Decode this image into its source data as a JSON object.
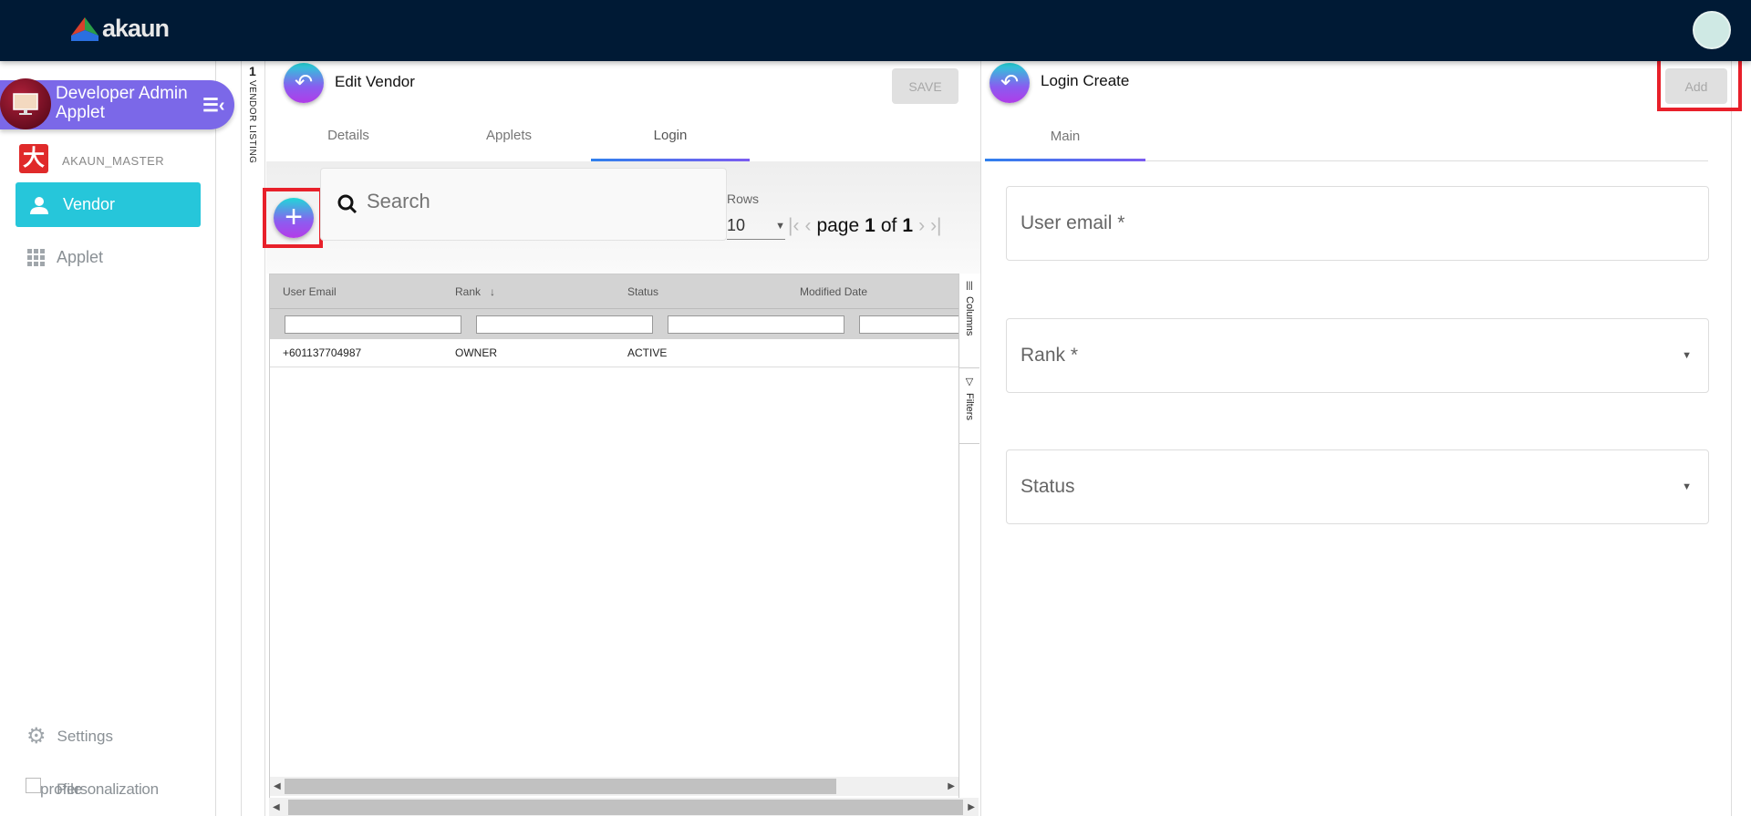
{
  "header": {
    "logo_text": "akaun",
    "avatar": "user-avatar"
  },
  "sidebar": {
    "app_title_line1": "Developer Admin",
    "app_title_line2": "Applet",
    "tenant": "AKAUN_MASTER",
    "items": [
      {
        "label": "Vendor",
        "icon": "person-icon",
        "active": true
      },
      {
        "label": "Applet",
        "icon": "grid-icon"
      }
    ],
    "settings": "Settings",
    "personalization_overlap_1": "profile",
    "personalization_overlap_2": "Personalization"
  },
  "strip": {
    "count": "1",
    "label": "VENDOR LISTING"
  },
  "left_panel": {
    "title": "Edit Vendor",
    "save_label": "SAVE",
    "tabs": [
      {
        "label": "Details"
      },
      {
        "label": "Applets"
      },
      {
        "label": "Login",
        "active": true
      }
    ],
    "search_placeholder": "Search",
    "rows_label": "Rows",
    "rows_value": "10",
    "pager": {
      "page_word": "page",
      "page": "1",
      "of_word": "of",
      "total": "1"
    },
    "columns": [
      "User Email",
      "Rank",
      "Status",
      "Modified Date"
    ],
    "rows": [
      [
        "+601137704987",
        "OWNER",
        "ACTIVE",
        ""
      ]
    ],
    "side_tabs": [
      "Columns",
      "Filters"
    ]
  },
  "right_panel": {
    "title": "Login Create",
    "add_label": "Add",
    "tabs": [
      {
        "label": "Main",
        "active": true
      }
    ],
    "fields": [
      {
        "label": "User email *",
        "type": "text"
      },
      {
        "label": "Rank *",
        "type": "select"
      },
      {
        "label": "Status",
        "type": "select"
      }
    ]
  },
  "colors": {
    "topbar": "#001a35",
    "accent": "#7b68e8",
    "vendor_active": "#26c6da",
    "highlight": "#e8202a"
  }
}
